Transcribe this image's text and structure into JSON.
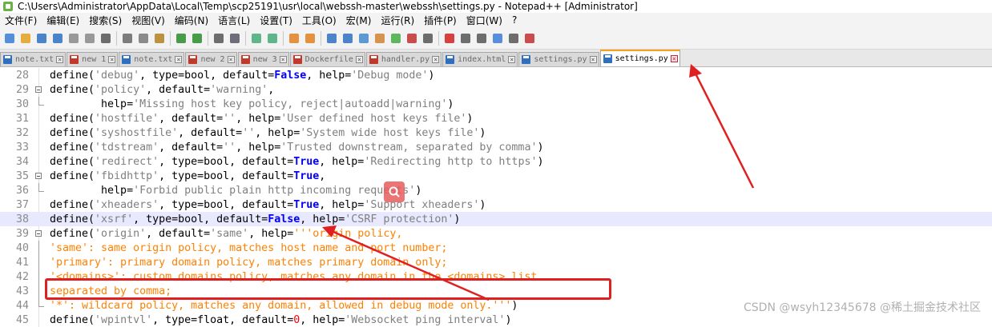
{
  "window": {
    "title": "C:\\Users\\Administrator\\AppData\\Local\\Temp\\scp25191\\usr\\local\\webssh-master\\webssh\\settings.py - Notepad++ [Administrator]"
  },
  "menu": [
    "文件(F)",
    "编辑(E)",
    "搜索(S)",
    "视图(V)",
    "编码(N)",
    "语言(L)",
    "设置(T)",
    "工具(O)",
    "宏(M)",
    "运行(R)",
    "插件(P)",
    "窗口(W)",
    "?"
  ],
  "tabs": [
    {
      "label": "note.txt",
      "state": "saved"
    },
    {
      "label": "new 1",
      "state": "unsaved"
    },
    {
      "label": "note.txt",
      "state": "saved"
    },
    {
      "label": "new 2",
      "state": "unsaved"
    },
    {
      "label": "new 3",
      "state": "unsaved"
    },
    {
      "label": "Dockerfile",
      "state": "unsaved"
    },
    {
      "label": "handler.py",
      "state": "unsaved"
    },
    {
      "label": "index.html",
      "state": "saved"
    },
    {
      "label": "settings.py",
      "state": "saved"
    },
    {
      "label": "settings.py",
      "state": "saved",
      "active": true
    }
  ],
  "toolbar_icons": [
    "new-file-icon",
    "open-file-icon",
    "save-icon",
    "save-all-icon",
    "close-icon",
    "close-all-icon",
    "print-icon",
    "cut-icon",
    "copy-icon",
    "paste-icon",
    "undo-icon",
    "redo-icon",
    "find-icon",
    "replace-icon",
    "zoom-in-icon",
    "zoom-out-icon",
    "sync-v-icon",
    "sync-h-icon",
    "wrap-icon",
    "all-chars-icon",
    "indent-guide-icon",
    "doc-map-icon",
    "function-list-icon",
    "folder-workspace-icon",
    "monitor-icon",
    "record-macro-icon",
    "stop-record-icon",
    "play-macro-icon",
    "run-macro-multiple-icon",
    "save-macro-icon",
    "spellcheck-icon"
  ],
  "editor": {
    "current_line": "38",
    "lines": [
      {
        "num": "28",
        "fold": "none",
        "tokens": [
          [
            "k",
            "define("
          ],
          [
            "s",
            "'debug'"
          ],
          [
            "k",
            ", type=bool, default="
          ],
          [
            "b",
            "False"
          ],
          [
            "k",
            ", help="
          ],
          [
            "s",
            "'Debug mode'"
          ],
          [
            "k",
            ")"
          ]
        ]
      },
      {
        "num": "29",
        "fold": "open",
        "tokens": [
          [
            "k",
            "define("
          ],
          [
            "s",
            "'policy'"
          ],
          [
            "k",
            ", default="
          ],
          [
            "s",
            "'warning'"
          ],
          [
            "k",
            ","
          ]
        ]
      },
      {
        "num": "30",
        "fold": "end",
        "tokens": [
          [
            "k",
            "        help="
          ],
          [
            "s",
            "'Missing host key policy, reject|autoadd|warning'"
          ],
          [
            "k",
            ")"
          ]
        ]
      },
      {
        "num": "31",
        "fold": "none",
        "tokens": [
          [
            "k",
            "define("
          ],
          [
            "s",
            "'hostfile'"
          ],
          [
            "k",
            ", default="
          ],
          [
            "s",
            "''"
          ],
          [
            "k",
            ", help="
          ],
          [
            "s",
            "'User defined host keys file'"
          ],
          [
            "k",
            ")"
          ]
        ]
      },
      {
        "num": "32",
        "fold": "none",
        "tokens": [
          [
            "k",
            "define("
          ],
          [
            "s",
            "'syshostfile'"
          ],
          [
            "k",
            ", default="
          ],
          [
            "s",
            "''"
          ],
          [
            "k",
            ", help="
          ],
          [
            "s",
            "'System wide host keys file'"
          ],
          [
            "k",
            ")"
          ]
        ]
      },
      {
        "num": "33",
        "fold": "none",
        "tokens": [
          [
            "k",
            "define("
          ],
          [
            "s",
            "'tdstream'"
          ],
          [
            "k",
            ", default="
          ],
          [
            "s",
            "''"
          ],
          [
            "k",
            ", help="
          ],
          [
            "s",
            "'Trusted downstream, separated by comma'"
          ],
          [
            "k",
            ")"
          ]
        ]
      },
      {
        "num": "34",
        "fold": "none",
        "tokens": [
          [
            "k",
            "define("
          ],
          [
            "s",
            "'redirect'"
          ],
          [
            "k",
            ", type=bool, default="
          ],
          [
            "b",
            "True"
          ],
          [
            "k",
            ", help="
          ],
          [
            "s",
            "'Redirecting http to https'"
          ],
          [
            "k",
            ")"
          ]
        ]
      },
      {
        "num": "35",
        "fold": "open",
        "tokens": [
          [
            "k",
            "define("
          ],
          [
            "s",
            "'fbidhttp'"
          ],
          [
            "k",
            ", type=bool, default="
          ],
          [
            "b",
            "True"
          ],
          [
            "k",
            ","
          ]
        ]
      },
      {
        "num": "36",
        "fold": "end",
        "tokens": [
          [
            "k",
            "        help="
          ],
          [
            "s",
            "'Forbid public plain http incoming requests'"
          ],
          [
            "k",
            ")"
          ]
        ]
      },
      {
        "num": "37",
        "fold": "none",
        "tokens": [
          [
            "k",
            "define("
          ],
          [
            "s",
            "'xheaders'"
          ],
          [
            "k",
            ", type=bool, default="
          ],
          [
            "b",
            "True"
          ],
          [
            "k",
            ", help="
          ],
          [
            "s",
            "'Support xheaders'"
          ],
          [
            "k",
            ")"
          ]
        ]
      },
      {
        "num": "38",
        "fold": "none",
        "tokens": [
          [
            "k",
            "define("
          ],
          [
            "s",
            "'xsrf'"
          ],
          [
            "k",
            ", type=bool, default="
          ],
          [
            "b",
            "False"
          ],
          [
            "k",
            ", help="
          ],
          [
            "s",
            "'CSRF protection'"
          ],
          [
            "k",
            ")"
          ]
        ]
      },
      {
        "num": "39",
        "fold": "open",
        "tokens": [
          [
            "k",
            "define("
          ],
          [
            "s",
            "'origin'"
          ],
          [
            "k",
            ", default="
          ],
          [
            "s",
            "'same'"
          ],
          [
            "k",
            ", help="
          ],
          [
            "o",
            "'''origin policy,"
          ]
        ]
      },
      {
        "num": "40",
        "fold": "line",
        "tokens": [
          [
            "o",
            "'same': same origin policy, matches host name and port number;"
          ]
        ]
      },
      {
        "num": "41",
        "fold": "line",
        "tokens": [
          [
            "o",
            "'primary': primary domain policy, matches primary domain only;"
          ]
        ]
      },
      {
        "num": "42",
        "fold": "line",
        "tokens": [
          [
            "o",
            "'<domains>': custom domains policy, matches any domain in the <domains> list"
          ]
        ]
      },
      {
        "num": "43",
        "fold": "line",
        "tokens": [
          [
            "o",
            "separated by comma;"
          ]
        ]
      },
      {
        "num": "44",
        "fold": "end",
        "tokens": [
          [
            "o",
            "'*': wildcard policy, matches any domain, allowed in debug mode only.'''"
          ],
          [
            "k",
            ")"
          ]
        ]
      },
      {
        "num": "45",
        "fold": "none",
        "tokens": [
          [
            "k",
            "define("
          ],
          [
            "s",
            "'wpintvl'"
          ],
          [
            "k",
            ", type=float, default="
          ],
          [
            "n",
            "0"
          ],
          [
            "k",
            ", help="
          ],
          [
            "s",
            "'Websocket ping interval'"
          ],
          [
            "k",
            ")"
          ]
        ]
      }
    ]
  },
  "watermark": "CSDN @wsyh12345678",
  "watermark2": "@稀土掘金技术社区",
  "colors": {
    "highlight": "#e02020",
    "arrow": "#e02020",
    "keyword_bool": "#0000ff",
    "string": "#7f7f7f",
    "docstring": "#ff8000"
  }
}
